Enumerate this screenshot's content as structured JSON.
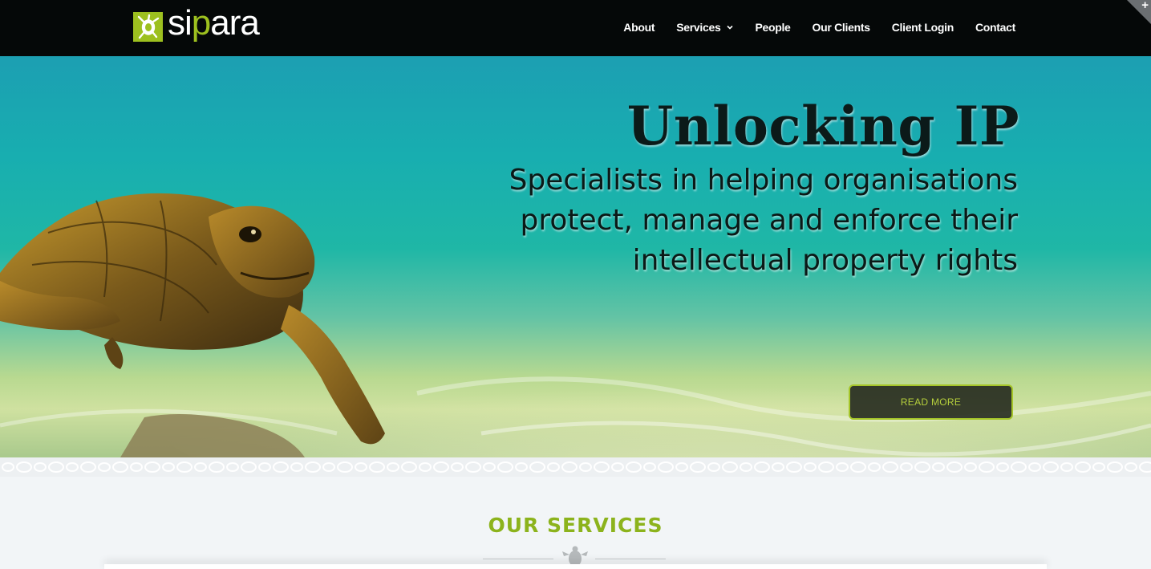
{
  "header": {
    "logo": {
      "prefix": "si",
      "accent": "p",
      "suffix": "ara"
    },
    "nav": [
      {
        "label": "About"
      },
      {
        "label": "Services",
        "has_dropdown": true
      },
      {
        "label": "People"
      },
      {
        "label": "Our Clients"
      },
      {
        "label": "Client Login"
      },
      {
        "label": "Contact"
      }
    ],
    "corner_symbol": "+"
  },
  "hero": {
    "title": "Unlocking IP",
    "subtitle_lines": [
      "Specialists in helping organisations",
      "protect, manage and enforce their",
      "intellectual property rights"
    ],
    "button_label": "READ MORE"
  },
  "services": {
    "title": "OUR SERVICES"
  },
  "colors": {
    "brand_green": "#9dc01f",
    "header_bg": "#050808",
    "services_title": "#8cb31c"
  },
  "icons": [
    "turtle-logo-icon",
    "chevron-down-icon",
    "plus-icon",
    "turtle-separator-icon"
  ]
}
